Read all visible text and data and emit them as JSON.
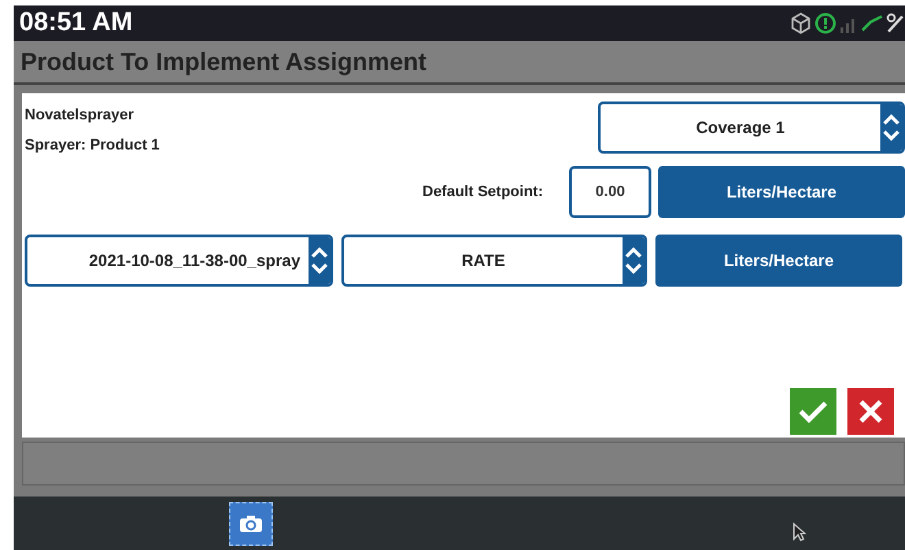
{
  "status_bar": {
    "time": "08:51 AM"
  },
  "title": "Product To Implement Assignment",
  "implement": {
    "name": "Novatelsprayer",
    "product": "Sprayer: Product 1",
    "coverage": "Coverage 1"
  },
  "setpoint": {
    "label": "Default Setpoint:",
    "value": "0.00",
    "unit": "Liters/Hectare"
  },
  "prescription": {
    "file": "2021-10-08_11-38-00_spray",
    "mode": "RATE",
    "unit": "Liters/Hectare"
  }
}
